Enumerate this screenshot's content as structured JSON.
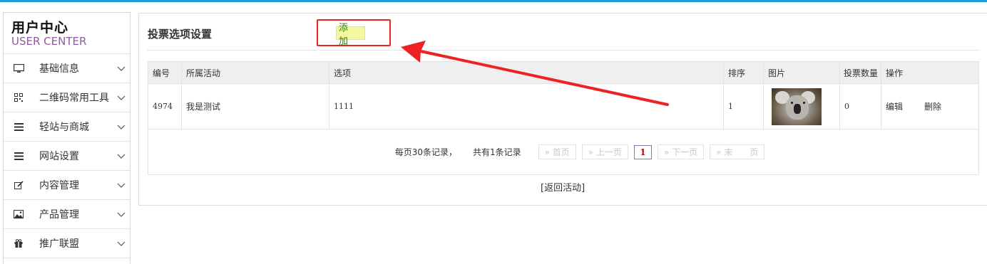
{
  "sidebar": {
    "title": "用户中心",
    "subtitle": "USER CENTER",
    "items": [
      {
        "label": "基础信息",
        "icon": "monitor-icon"
      },
      {
        "label": "二维码常用工具",
        "icon": "qrcode-icon"
      },
      {
        "label": "轻站与商城",
        "icon": "list-icon"
      },
      {
        "label": "网站设置",
        "icon": "list-icon"
      },
      {
        "label": "内容管理",
        "icon": "edit-icon"
      },
      {
        "label": "产品管理",
        "icon": "image-icon"
      },
      {
        "label": "推广联盟",
        "icon": "gift-icon"
      }
    ]
  },
  "panel": {
    "title": "投票选项设置",
    "add_label": "添 加",
    "back_link": "[返回活动]"
  },
  "table": {
    "headers": [
      "编号",
      "所属活动",
      "选项",
      "排序",
      "图片",
      "投票数量",
      "操作"
    ],
    "rows": [
      {
        "id": "4974",
        "activity": "我是测试",
        "option": "1111",
        "order": "1",
        "image": "koala-thumbnail",
        "votes": "0",
        "edit": "编辑",
        "delete": "删除"
      }
    ]
  },
  "pager": {
    "per_page": "每页30条记录，",
    "total": "共有1条记录",
    "first": "» 首页",
    "prev": "» 上一页",
    "current": "1",
    "next": "» 下一页",
    "last": "» 末　　页"
  },
  "colors": {
    "accent_top": "#1a9ad6",
    "subtitle": "#8e5aa1",
    "annotation": "#ee2222",
    "add_button_bg": "#f3f89e"
  }
}
